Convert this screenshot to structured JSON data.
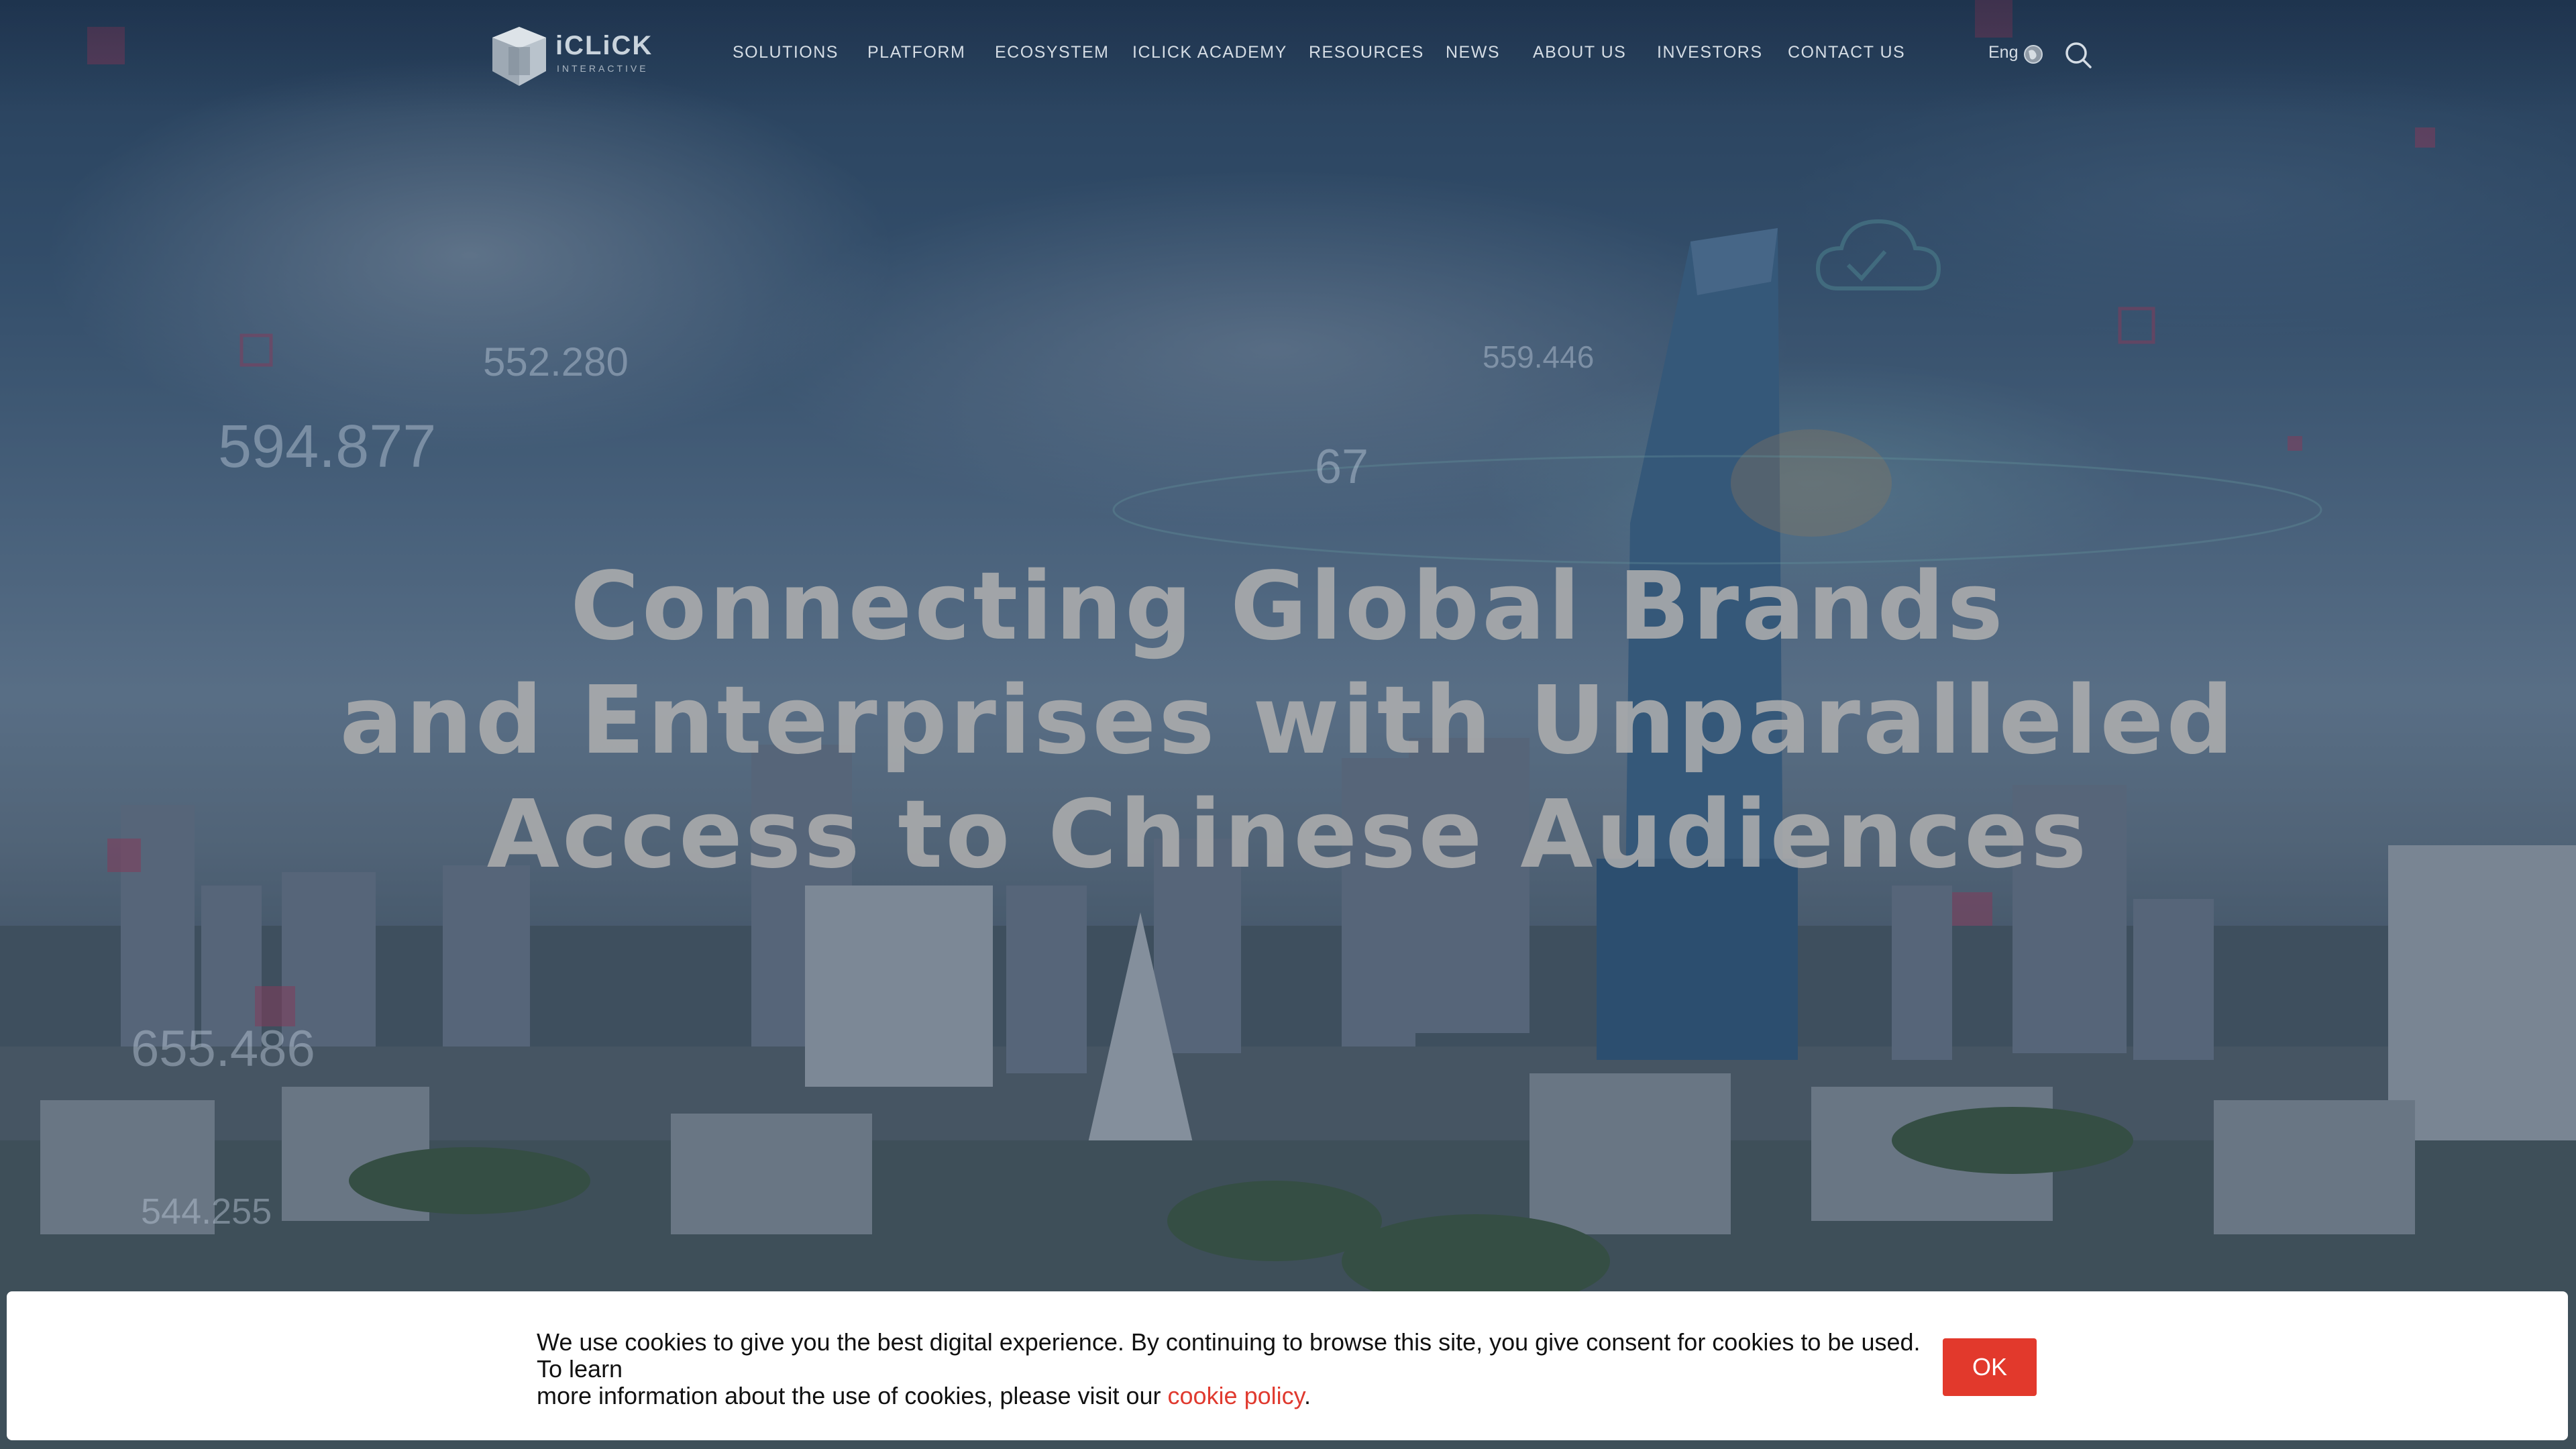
{
  "brand": {
    "logo_main": "iCLiCK",
    "logo_sub": "INTERACTIVE"
  },
  "nav": {
    "items": [
      {
        "label": "SOLUTIONS"
      },
      {
        "label": "PLATFORM"
      },
      {
        "label": "ECOSYSTEM"
      },
      {
        "label": "ICLICK ACADEMY"
      },
      {
        "label": "RESOURCES"
      },
      {
        "label": "NEWS"
      },
      {
        "label": "ABOUT US"
      },
      {
        "label": "INVESTORS"
      },
      {
        "label": "CONTACT US"
      }
    ],
    "language": "Eng"
  },
  "hero": {
    "headline": [
      "Connecting Global Brands",
      "and Enterprises with Unparalleled",
      "Access to Chinese Audiences"
    ],
    "floating_numbers": [
      "594.877",
      "552.280",
      "559.446",
      "655.486",
      "544.255",
      "67"
    ]
  },
  "cookie": {
    "text_line1": "We use cookies to give you the best digital experience. By continuing to browse this site, you give consent for cookies to be used.  To learn",
    "text_line2": "more information about the use of cookies, please visit our ",
    "link_text": "cookie policy",
    "text_end": ".",
    "ok_label": "OK"
  },
  "colors": {
    "accent": "#e2392c",
    "link": "#e03a2f",
    "overlay": "#142842"
  },
  "icons": [
    "logo-icon",
    "globe-icon",
    "search-icon"
  ]
}
